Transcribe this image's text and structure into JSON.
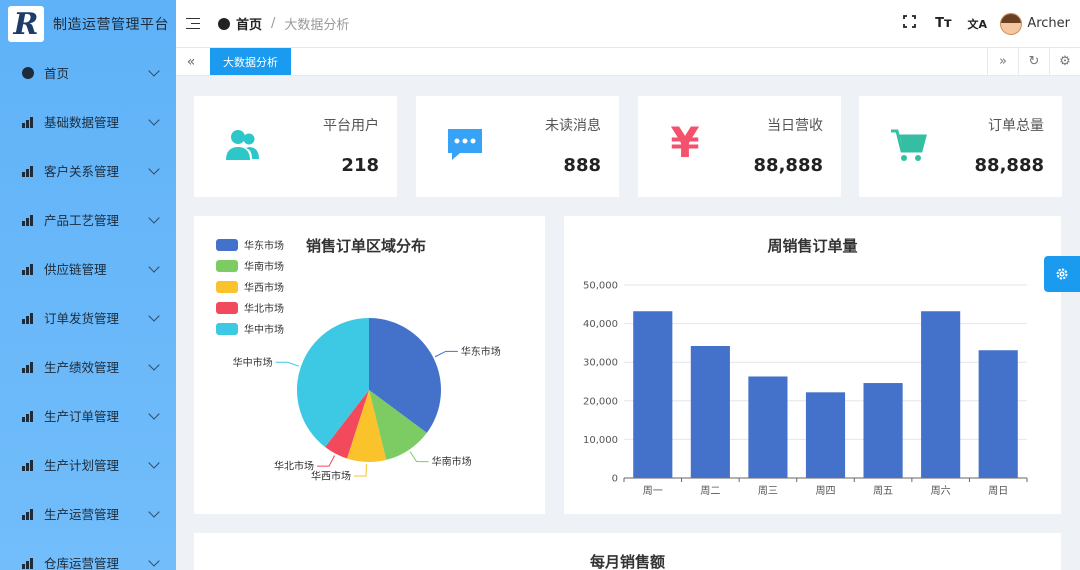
{
  "app": {
    "logo_letter": "R",
    "title": "制造运营管理平台"
  },
  "sidebar": {
    "items": [
      {
        "label": "首页",
        "icon": "dashboard-icon"
      },
      {
        "label": "基础数据管理",
        "icon": "bar-chart-icon"
      },
      {
        "label": "客户关系管理",
        "icon": "bar-chart-icon"
      },
      {
        "label": "产品工艺管理",
        "icon": "bar-chart-icon"
      },
      {
        "label": "供应链管理",
        "icon": "bar-chart-icon"
      },
      {
        "label": "订单发货管理",
        "icon": "bar-chart-icon"
      },
      {
        "label": "生产绩效管理",
        "icon": "bar-chart-icon"
      },
      {
        "label": "生产订单管理",
        "icon": "bar-chart-icon"
      },
      {
        "label": "生产计划管理",
        "icon": "bar-chart-icon"
      },
      {
        "label": "生产运营管理",
        "icon": "bar-chart-icon"
      },
      {
        "label": "仓库运营管理",
        "icon": "bar-chart-icon"
      }
    ]
  },
  "header": {
    "breadcrumb_home": "首页",
    "breadcrumb_sep": "/",
    "breadcrumb_current": "大数据分析",
    "user_name": "Archer",
    "fullscreen_icon": "fullscreen-icon",
    "fontsize_icon_text": "Tт",
    "translate_icon_text": "文A"
  },
  "tabs": {
    "active_label": "大数据分析",
    "left_nav": "«",
    "right_nav": "»",
    "refresh": "↻",
    "settings": "⚙"
  },
  "stats": [
    {
      "title": "平台用户",
      "value": "218",
      "icon": "users-icon",
      "color": "#2ec7c9"
    },
    {
      "title": "未读消息",
      "value": "888",
      "icon": "message-icon",
      "color": "#36a3f7"
    },
    {
      "title": "当日营收",
      "value": "88,888",
      "icon": "yen-icon",
      "color": "#f4516c",
      "symbol": "¥"
    },
    {
      "title": "订单总量",
      "value": "88,888",
      "icon": "cart-icon",
      "color": "#34bfa3"
    }
  ],
  "pie_chart": {
    "title": "销售订单区域分布",
    "chart_data": {
      "type": "pie",
      "title": "销售订单区域分布",
      "legend_position": "top-left",
      "slices": [
        {
          "name": "华东市场",
          "value": 320,
          "color": "#4472ca"
        },
        {
          "name": "华南市场",
          "value": 100,
          "color": "#7ccc63"
        },
        {
          "name": "华西市场",
          "value": 80,
          "color": "#fac22b"
        },
        {
          "name": "华北市场",
          "value": 50,
          "color": "#f2495c"
        },
        {
          "name": "华中市场",
          "value": 360,
          "color": "#3dc9e3"
        }
      ]
    }
  },
  "bar_chart": {
    "title": "周销售订单量",
    "chart_data": {
      "type": "bar",
      "title": "周销售订单量",
      "categories": [
        "周一",
        "周二",
        "周三",
        "周四",
        "周五",
        "周六",
        "周日"
      ],
      "values": [
        43200,
        34200,
        26300,
        22200,
        24600,
        43200,
        33100
      ],
      "ylim": [
        0,
        50000
      ],
      "yticks": [
        "0",
        "10,000",
        "20,000",
        "30,000",
        "40,000",
        "50,000"
      ],
      "grid": true,
      "color": "#4472ca"
    }
  },
  "monthly_chart": {
    "title": "每月销售额"
  }
}
